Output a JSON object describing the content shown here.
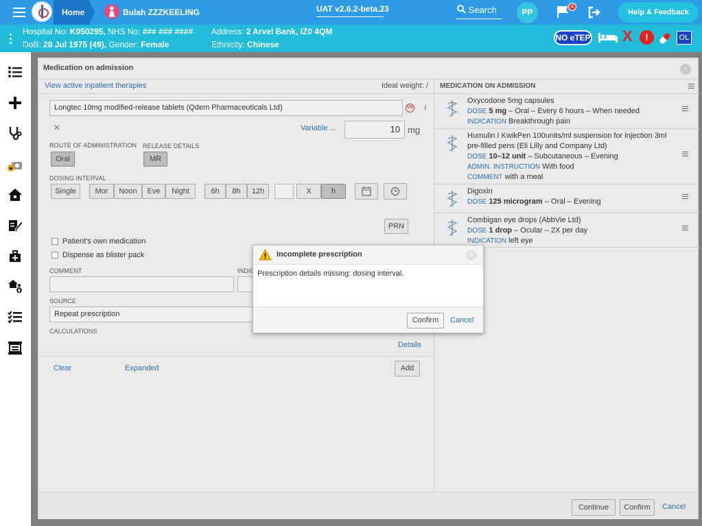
{
  "topbar": {
    "home_label": "Home",
    "patient_name": "Bulah ZZZKEELING",
    "environment": "UAT v2.6.2-beta.23",
    "search_label": "Search",
    "user_initials": "PP",
    "flag_count": "4",
    "help_label": "Help & Feedback"
  },
  "patient": {
    "hospital_label": "Hospital No:",
    "hospital_no": "K050295,",
    "nhs_label": "NHS No:",
    "nhs_no": "### ### ####",
    "address_label": "Address:",
    "address": "2 Arvel Bank, IZ0 4QM",
    "dob_label": "DoB:",
    "dob": "28 Jul 1975 (49),",
    "gender_label": "Gender:",
    "gender": "Female",
    "ethnicity_label": "Ethnicity:",
    "ethnicity": "Chinese",
    "etep_badge": "NO eTEP",
    "ol_badge": "OL",
    "alert_symbol": "!",
    "x_symbol": "X"
  },
  "panel": {
    "title": "Medication on admission",
    "close_symbol": "×",
    "view_therapies_link": "View active inpatient therapies",
    "ideal_weight": "Ideal weight: /",
    "drug_value": "Longtec 10mg modified-release tablets (Qdem Pharmaceuticals Ltd)",
    "cd_badge": "CD",
    "info_symbol": "i",
    "clear_symbol": "×",
    "variable_link": "Variable ...",
    "dose_value": "10",
    "dose_unit": "mg",
    "route_label": "ROUTE OF ADMINISTRATION",
    "route_value": "Oral",
    "release_label": "RELEASE DETAILS",
    "release_value": "MR",
    "dosing_label": "DOSING INTERVAL",
    "dosing_buttons": [
      "Single",
      "Mor",
      "Noon",
      "Eve",
      "Night",
      "6h",
      "8h",
      "12h",
      "X",
      "h"
    ],
    "prn_label": "PRN",
    "own_med_label": "Patient's own medication",
    "blister_label": "Dispense as blister pack",
    "comment_label": "COMMENT",
    "indication_label": "INDIC",
    "source_label": "SOURCE",
    "source_value": "Repeat prescription",
    "calculations_label": "CALCULATIONS",
    "details_link": "Details",
    "clear_link": "Clear",
    "expanded_link": "Expanded",
    "add_button": "Add"
  },
  "admission_list": {
    "header": "MEDICATION ON ADMISSION",
    "meds": [
      {
        "name": "Oxycodone 5mg capsules",
        "dose_kw": "DOSE",
        "dose_bold": "5 mg",
        "dose_rest": "– Oral – Every 6 hours – When needed",
        "line3_kw": "INDICATION",
        "line3": "Breakthrough pain"
      },
      {
        "name": "Humulin I KwikPen 100units/ml suspension for injection 3ml pre-filled pens (Eli Lilly and Company Ltd)",
        "dose_kw": "DOSE",
        "dose_bold": "10–12 unit",
        "dose_rest": "– Subcutaneous – Evening",
        "line3_kw": "ADMIN. INSTRUCTION",
        "line3": "With food",
        "line4_kw": "COMMENT",
        "line4": "with a meal"
      },
      {
        "name": "Digoxin",
        "dose_kw": "DOSE",
        "dose_bold": "125 microgram",
        "dose_rest": "– Oral – Evening"
      },
      {
        "name": "Combigan eye drops (AbbVie Ltd)",
        "dose_kw": "DOSE",
        "dose_bold": "1 drop",
        "dose_rest": "– Ocular – 2X per day",
        "line3_kw": "INDICATION",
        "line3": "left eye"
      }
    ]
  },
  "footer": {
    "continue_label": "Continue",
    "confirm_label": "Confirm",
    "cancel_label": "Cancel"
  },
  "dialog": {
    "title": "Incomplete prescription",
    "message": "Prescription details missing: dosing interval.",
    "confirm_label": "Confirm",
    "cancel_label": "Cancel",
    "close_symbol": "×",
    "warning_symbol": "!"
  }
}
